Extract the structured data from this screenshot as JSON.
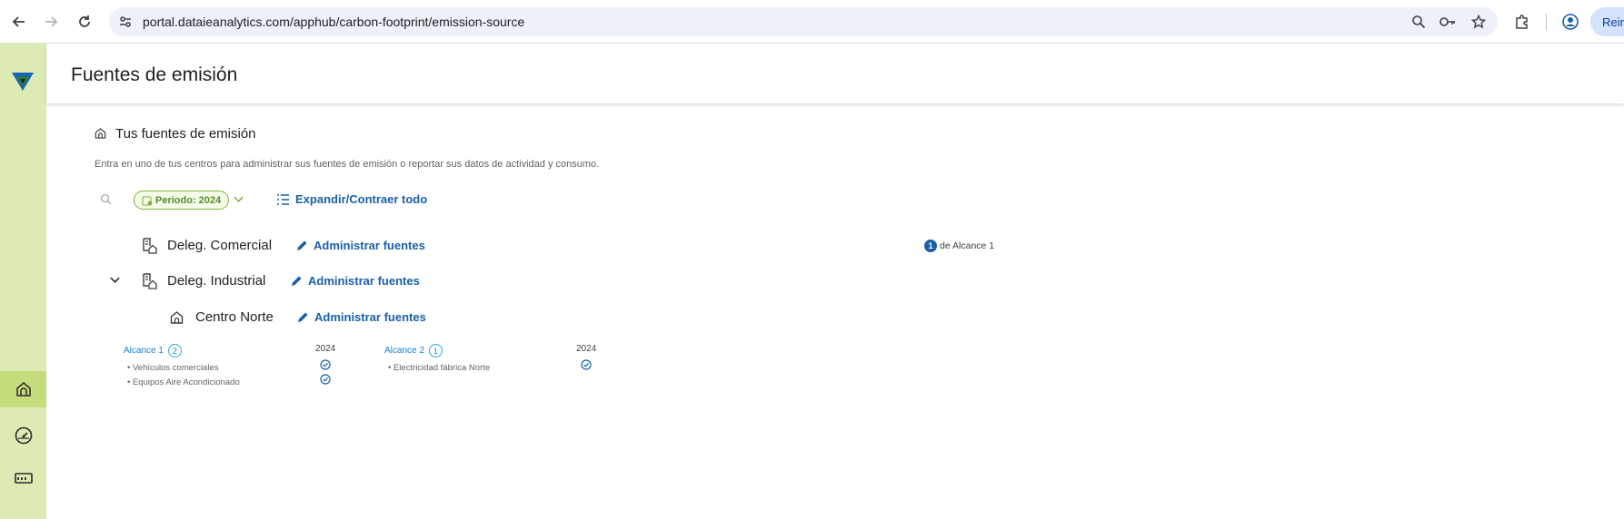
{
  "browser": {
    "url": "portal.dataieanalytics.com/apphub/carbon-footprint/emission-source",
    "profile_label": "Reini"
  },
  "app": {
    "page_title": "Fuentes de emisión"
  },
  "section": {
    "title": "Tus fuentes de emisión",
    "description": "Entra en uno de tus centros para administrar sus fuentes de emisión o reportar sus datos de actividad y consumo."
  },
  "toolbar": {
    "period_label": "Periodo: 2024",
    "expand_label": "Expandir/Contraer todo"
  },
  "tree": {
    "comercial": {
      "name": "Deleg. Comercial",
      "manage_label": "Administrar fuentes",
      "scope_count": "1",
      "scope_text": "de Alcance 1"
    },
    "industrial": {
      "name": "Deleg. Industrial",
      "manage_label": "Administrar fuentes"
    },
    "centro_norte": {
      "name": "Centro Norte",
      "manage_label": "Administrar fuentes"
    }
  },
  "scopes": [
    {
      "label": "Alcance 1",
      "count": "2",
      "year": "2024",
      "sources": [
        "Vehículos comerciales",
        "Equipos Aire Acondicionado"
      ]
    },
    {
      "label": "Alcance 2",
      "count": "1",
      "year": "2024",
      "sources": [
        "Electricidad fábrica Norte"
      ]
    }
  ],
  "colors": {
    "sidebar": "#dcebb4",
    "sidebar_active": "#c4dd7a",
    "link": "#1a5fa8",
    "period_green": "#7cb342"
  }
}
